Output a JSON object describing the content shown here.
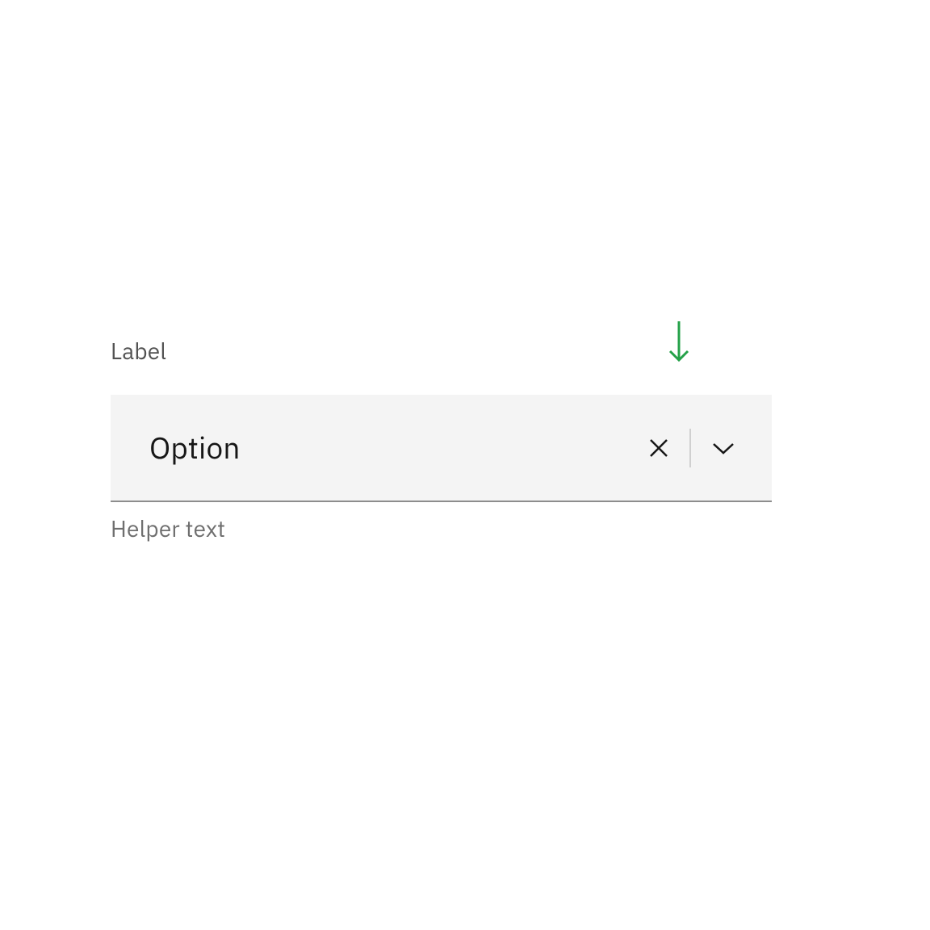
{
  "dropdown": {
    "label": "Label",
    "value": "Option",
    "helper_text": "Helper text"
  },
  "colors": {
    "arrow_green": "#24a148",
    "field_bg": "#f4f4f4",
    "field_border": "#8d8d8d",
    "text_primary": "#161616",
    "text_secondary": "#525252",
    "text_helper": "#6f6f6f"
  },
  "icons": {
    "arrow_down": "arrow-down-icon",
    "close": "close-icon",
    "chevron_down": "chevron-down-icon"
  }
}
